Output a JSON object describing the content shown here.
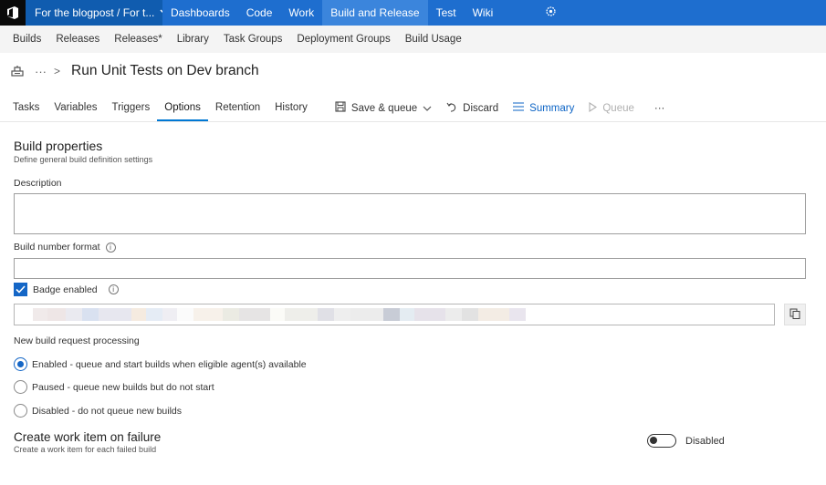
{
  "topbar": {
    "project": "For the blogpost / For t...",
    "nav": [
      "Dashboards",
      "Code",
      "Work",
      "Build and Release",
      "Test",
      "Wiki"
    ],
    "active": "Build and Release",
    "settings_icon": "gear-icon"
  },
  "subnav": [
    "Builds",
    "Releases",
    "Releases*",
    "Library",
    "Task Groups",
    "Deployment Groups",
    "Build Usage"
  ],
  "breadcrumb": {
    "dots": "···",
    "sep": ">",
    "title": "Run Unit Tests on Dev branch"
  },
  "tabs": [
    "Tasks",
    "Variables",
    "Triggers",
    "Options",
    "Retention",
    "History"
  ],
  "active_tab": "Options",
  "toolbar": {
    "save_queue": "Save & queue",
    "discard": "Discard",
    "summary": "Summary",
    "queue": "Queue",
    "more": "···"
  },
  "form": {
    "heading": "Build properties",
    "subheading": "Define general build definition settings",
    "description_label": "Description",
    "description_value": "",
    "build_number_label": "Build number format",
    "build_number_value": "",
    "badge_label": "Badge enabled",
    "badge_checked": true,
    "processing_label": "New build request processing",
    "processing_options": [
      "Enabled - queue and start builds when eligible agent(s) available",
      "Paused - queue new builds but do not start",
      "Disabled - do not queue new builds"
    ],
    "processing_selected": 0,
    "workitem_heading": "Create work item on failure",
    "workitem_sub": "Create a work item for each failed build",
    "workitem_toggle": "Disabled"
  },
  "colors": {
    "accent": "#1e6ecf",
    "brand_dark": "#105caf",
    "link": "#0b63c5"
  }
}
